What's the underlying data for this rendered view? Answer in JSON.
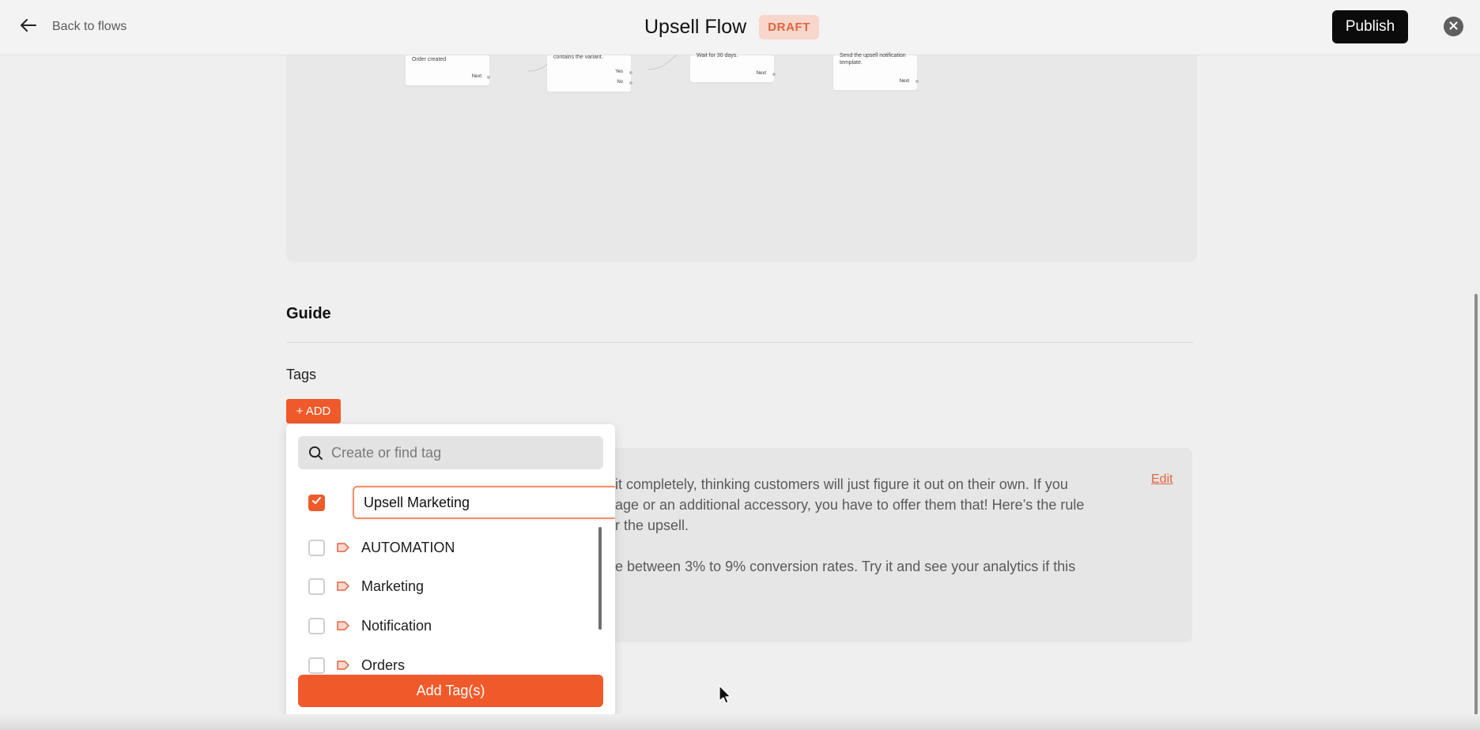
{
  "header": {
    "back_label": "Back to flows",
    "title": "Upsell Flow",
    "status_badge": "DRAFT",
    "publish_label": "Publish"
  },
  "canvas": {
    "nodes": [
      {
        "text": "Order created",
        "port_label": "Next"
      },
      {
        "text": "contains the variant.",
        "port_labels": [
          "Yes",
          "No"
        ]
      },
      {
        "text": "Wait for 30 days.",
        "port_label": "Next"
      },
      {
        "text": "Send the upsell notification template.",
        "port_label": "Next"
      }
    ]
  },
  "guide": {
    "heading": "Guide",
    "tags_label": "Tags",
    "add_button": "+ ADD",
    "edit_label": "Edit",
    "text_lines": [
      "it completely, thinking customers will just figure it out on their own. If you",
      "age or an additional accessory, you have to offer them that! Here’s the rule",
      "r the upsell.",
      "e between 3% to 9% conversion rates. Try it and see your analytics if this"
    ]
  },
  "tag_dropdown": {
    "search_placeholder": "Create or find tag",
    "new_tag_value": "Upsell Marketing",
    "new_tag_checked": true,
    "tags": [
      {
        "label": "AUTOMATION",
        "checked": false
      },
      {
        "label": "Marketing",
        "checked": false
      },
      {
        "label": "Notification",
        "checked": false
      },
      {
        "label": "Orders",
        "checked": false
      }
    ],
    "submit_label": "Add Tag(s)"
  },
  "colors": {
    "accent": "#f05a2a",
    "draft_bg": "#f8d6cb",
    "draft_text": "#e0643f",
    "publish_bg": "#0b0b0b"
  },
  "icons": [
    "arrow-left-icon",
    "close-icon",
    "search-icon",
    "checkmark-icon",
    "tag-icon",
    "mouse-cursor-icon"
  ]
}
